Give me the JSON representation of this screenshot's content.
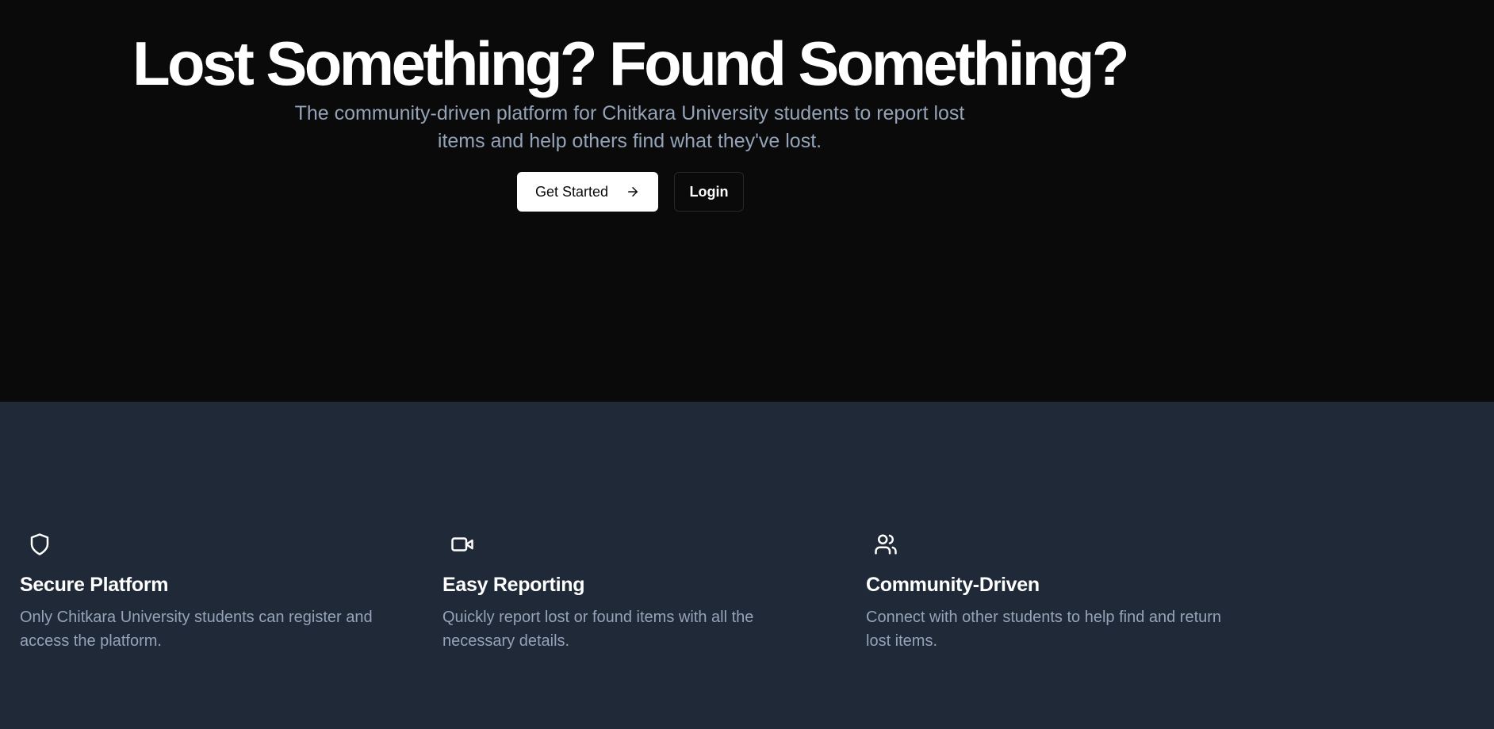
{
  "hero": {
    "title": "Lost Something? Found Something?",
    "subtitle": "The community-driven platform for Chitkara University students to report lost items and help others find what they've lost.",
    "get_started_label": "Get Started",
    "login_label": "Login"
  },
  "features": [
    {
      "icon": "shield-icon",
      "title": "Secure Platform",
      "description": "Only Chitkara University students can register and access the platform."
    },
    {
      "icon": "video-icon",
      "title": "Easy Reporting",
      "description": "Quickly report lost or found items with all the necessary details."
    },
    {
      "icon": "users-icon",
      "title": "Community-Driven",
      "description": "Connect with other students to help find and return lost items."
    }
  ],
  "colors": {
    "hero_background": "#0a0a0a",
    "features_background": "#1f2937",
    "muted_text": "#94a3b8"
  }
}
